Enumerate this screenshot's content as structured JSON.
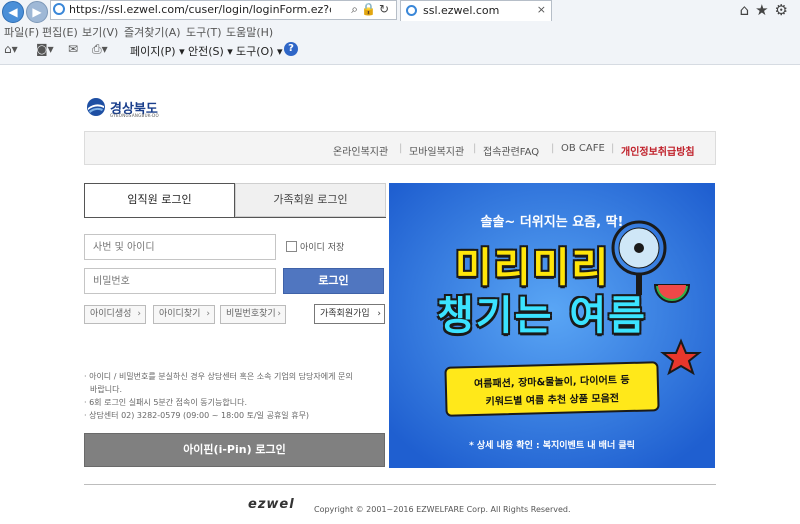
{
  "browser": {
    "address_url": "https://ssl.ezwel.com/cuser/login/loginForm.ez?clientCd=gb",
    "tab_title": "ssl.ezwel.com",
    "tab_close": "×",
    "menu": [
      "파일(F)",
      "편집(E)",
      "보기(V)",
      "즐겨찾기(A)",
      "도구(T)",
      "도움말(H)"
    ],
    "toolbar": {
      "page_label": "페이지(P) ▾",
      "safety_label": "안전(S) ▾",
      "tools_label": "도구(O) ▾",
      "help_glyph": "?"
    },
    "icons": [
      "back-icon",
      "forward-icon",
      "search-icon",
      "lock-icon",
      "refresh-icon",
      "home-icon",
      "star-icon",
      "gear-icon",
      "rss-icon",
      "mail-icon",
      "print-icon",
      "help-icon"
    ]
  },
  "brand": {
    "name": "경상북도",
    "sub": "GYEONGSANGBUK-DO"
  },
  "topnav": {
    "links": [
      "온라인복지관",
      "모바일복지관",
      "접속관련FAQ",
      "OB CAFE"
    ],
    "privacy": "개인정보취급방침"
  },
  "login": {
    "tab_staff": "임직원 로그인",
    "tab_family": "가족회원 로그인",
    "id_placeholder": "사번 및 아이디",
    "pw_placeholder": "비밀번호",
    "save_id_label": "아이디 저장",
    "login_button": "로그인",
    "create_id": "아이디생성",
    "find_id": "아이디찾기",
    "find_pw": "비밀번호찾기",
    "family_join": "가족회원가입",
    "notes": [
      "· 아이디 / 비밀번호를 분실하신 경우 상담센터 혹은 소속 기업의 담당자에게 문의",
      "  바랍니다.",
      "· 6회 로그인 실패시 5분간 접속이 동기능합니다.",
      "· 상담센터 02) 3282-0579 (09:00 ~ 18:00 토/일 공휴일 휴무)"
    ],
    "ipin_button": "아이핀(i-Pin) 로그인"
  },
  "banner": {
    "caption": "솔솔~ 더위지는 요즘, 딱!",
    "headline1": "미리미리",
    "headline2": "챙기는 여름",
    "box_line1": "여름패션, 장마&물놀이, 다이어트 등",
    "box_line2": "키워드별 여름 추천 상품 모음전",
    "footnote": "* 상세 내용 확인 : 복지이벤트 내 배너 클릭"
  },
  "footer": {
    "logo": "ezwel",
    "copyright": "Copyright © 2001~2016 EZWELFARE Corp. All Rights Reserved."
  },
  "colors": {
    "login_button": "#5076c0",
    "ipin_button": "#808080",
    "privacy_link": "#c0202a",
    "banner_bg": "#2f78e0",
    "banner_yellow": "#ffe60a",
    "banner_cyan": "#3be3ff"
  }
}
